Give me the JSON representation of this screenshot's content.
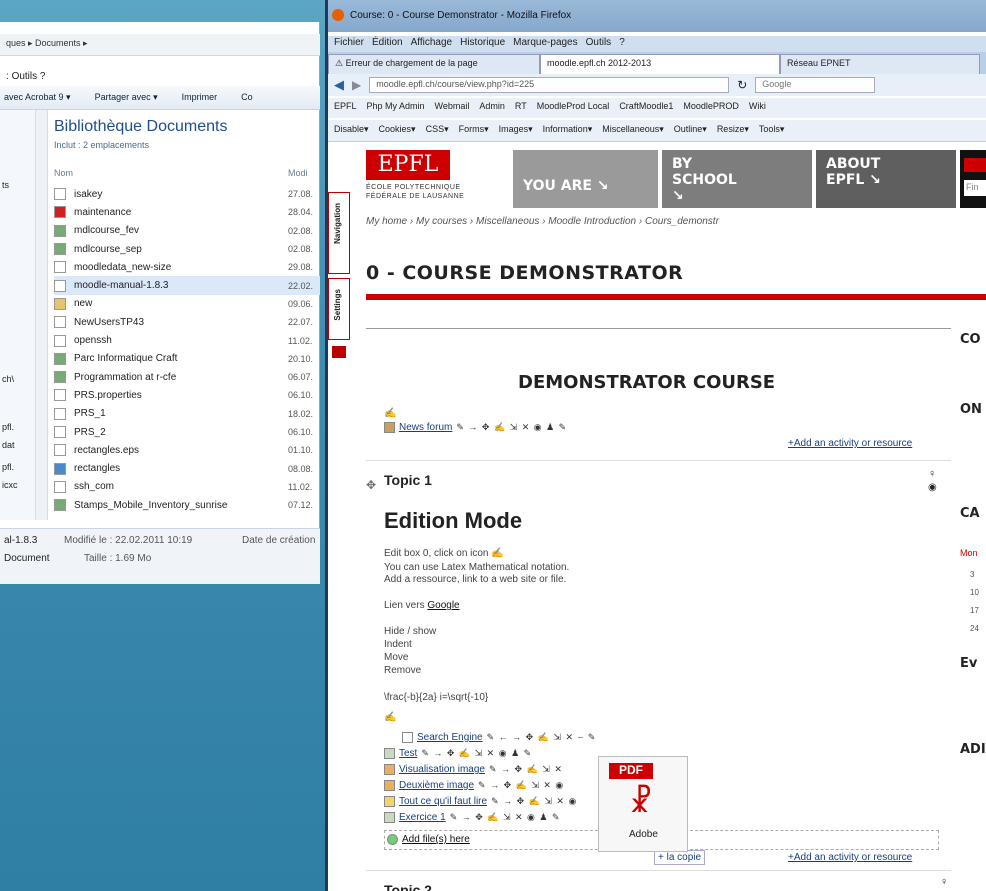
{
  "explorer": {
    "address": "ques ▸ Documents ▸",
    "menu": "Outils ?",
    "menu_prefix": ":",
    "toolbar": [
      "avec Acrobat 9 ▾",
      "Partager avec ▾",
      "Imprimer",
      "Co"
    ],
    "nav_items": [
      "ts",
      "ch\\",
      "pfl.",
      "dat",
      "pfl.",
      "icxc"
    ],
    "lib_title": "Bibliothèque Documents",
    "lib_sub": "Inclut : 2 emplacements",
    "col_name": "Nom",
    "col_mod": "Modi",
    "files": [
      {
        "name": "isakey",
        "date": "27.08."
      },
      {
        "name": "maintenance",
        "date": "28.04."
      },
      {
        "name": "mdlcourse_fev",
        "date": "02.08."
      },
      {
        "name": "mdlcourse_sep",
        "date": "02.08."
      },
      {
        "name": "moodledata_new-size",
        "date": "29.08."
      },
      {
        "name": "moodle-manual-1.8.3",
        "date": "22.02."
      },
      {
        "name": "new",
        "date": "09.06."
      },
      {
        "name": "NewUsersTP43",
        "date": "22.07."
      },
      {
        "name": "openssh",
        "date": "11.02."
      },
      {
        "name": "Parc Informatique Craft",
        "date": "20.10."
      },
      {
        "name": "Programmation at r-cfe",
        "date": "06.07."
      },
      {
        "name": "PRS.properties",
        "date": "06.10."
      },
      {
        "name": "PRS_1",
        "date": "18.02."
      },
      {
        "name": "PRS_2",
        "date": "06.10."
      },
      {
        "name": "rectangles.eps",
        "date": "01.10."
      },
      {
        "name": "rectangles",
        "date": "08.08."
      },
      {
        "name": "ssh_com",
        "date": "11.02."
      },
      {
        "name": "Stamps_Mobile_Inventory_sunrise",
        "date": "07.12."
      }
    ],
    "status_name": "al-1.8.3",
    "status_type": "Document",
    "status_mod": "Modifié le : 22.02.2011 10:19",
    "status_size": "Taille : 1.69 Mo",
    "status_created": "Date de création"
  },
  "firefox": {
    "title": "Course: 0 - Course Demonstrator - Mozilla Firefox",
    "menu": [
      "Fichier",
      "Édition",
      "Affichage",
      "Historique",
      "Marque-pages",
      "Outils",
      "?"
    ],
    "tabs": [
      "Erreur de chargement de la page",
      "moodle.epfl.ch 2012-2013",
      "Réseau EPNET"
    ],
    "url": "moodle.epfl.ch/course/view.php?id=225",
    "search": "Google",
    "bookmarks": [
      "EPFL",
      "Php My Admin",
      "Webmail",
      "Admin",
      "RT",
      "MoodleProd Local",
      "CraftMoodle1",
      "MoodlePROD",
      "Wiki"
    ],
    "devbar": [
      "Disable▾",
      "Cookies▾",
      "CSS▾",
      "Forms▾",
      "Images▾",
      "Information▾",
      "Miscellaneous▾",
      "Outline▾",
      "Resize▾",
      "Tools▾"
    ]
  },
  "page": {
    "side_nav": "Navigation",
    "side_settings": "Settings",
    "logo": "EPFL",
    "logo_line1": "ÉCOLE POLYTECHNIQUE",
    "logo_line2": "FÉDÉRALE DE LAUSANNE",
    "nav": [
      {
        "label": "YOU ARE ↘"
      },
      {
        "label": "BY SCHOOL ↘"
      },
      {
        "label": "ABOUT EPFL ↘"
      }
    ],
    "breadcrumb": "My home › My courses › Miscellaneous › Moodle Introduction › Cours_demonstr",
    "course_title": "0 - COURSE DEMONSTRATOR",
    "demo_title": "DEMONSTRATOR COURSE",
    "news_forum": "News forum",
    "add_activity": "+Add an activity or resource",
    "topic1": "Topic 1",
    "edition_mode": "Edition Mode",
    "para1": "Edit box 0, click on icon",
    "para2": "You can use Latex Mathematical notation.",
    "para3": "Add a ressource, link to a web site or file.",
    "lien": "Lien vers",
    "google": "Google",
    "hide": "Hide / show",
    "indent": "Indent",
    "move": "Move",
    "remove": "Remove",
    "latex": "\\frac{-b}{2a} i=\\sqrt{-10}",
    "items": [
      "Search Engine",
      "Test",
      "Visualisation image",
      "Deuxième image",
      "Tout ce qu'il faut lire",
      "Exercice 1"
    ],
    "add_file": "Add file(s) here",
    "copy": "+ la copie",
    "pdf_label": "PDF",
    "pdf_sub": "Adobe",
    "topic2": "Topic 2",
    "right_heads": [
      "CO",
      "ON",
      "CA",
      "Ev",
      "ADI"
    ],
    "right_search": "Fin",
    "mon": "Mon",
    "cal_nums": [
      "3",
      "10",
      "17",
      "24"
    ]
  }
}
